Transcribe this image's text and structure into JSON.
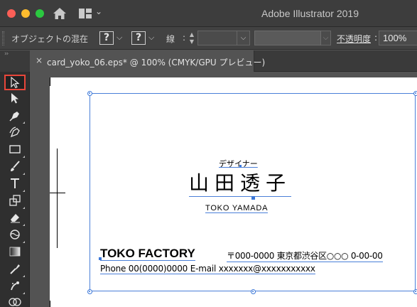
{
  "window": {
    "app_title": "Adobe Illustrator 2019"
  },
  "controlbar": {
    "object_label": "オブジェクトの混在",
    "fill_value": "?",
    "stroke_value": "?",
    "stroke_label": "線",
    "stroke_colon": ":",
    "opacity_label": "不透明度",
    "opacity_value": "100%"
  },
  "tab": {
    "close": "×",
    "label": "card_yoko_06.eps* @ 100% (CMYK/GPU プレビュー)"
  },
  "tools": [
    {
      "name": "selection-tool",
      "selected": true
    },
    {
      "name": "direct-selection-tool"
    },
    {
      "name": "pen-tool"
    },
    {
      "name": "curvature-tool"
    },
    {
      "name": "rectangle-tool"
    },
    {
      "name": "paintbrush-tool"
    },
    {
      "name": "type-tool"
    },
    {
      "name": "scale-tool"
    },
    {
      "name": "eraser-tool"
    },
    {
      "name": "warp-tool"
    },
    {
      "name": "gradient-tool"
    },
    {
      "name": "eyedropper-tool"
    },
    {
      "name": "symbol-sprayer-tool"
    },
    {
      "name": "shape-builder-tool"
    }
  ],
  "card": {
    "title_jp": "デザイナー",
    "name_jp": "山田透子",
    "name_en": "TOKO YAMADA",
    "company": "TOKO FACTORY",
    "address": "〒000-0000 東京都渋谷区○○○ 0-00-00",
    "contact": "Phone 00(0000)0000 E-mail xxxxxxx@xxxxxxxxxxx"
  }
}
